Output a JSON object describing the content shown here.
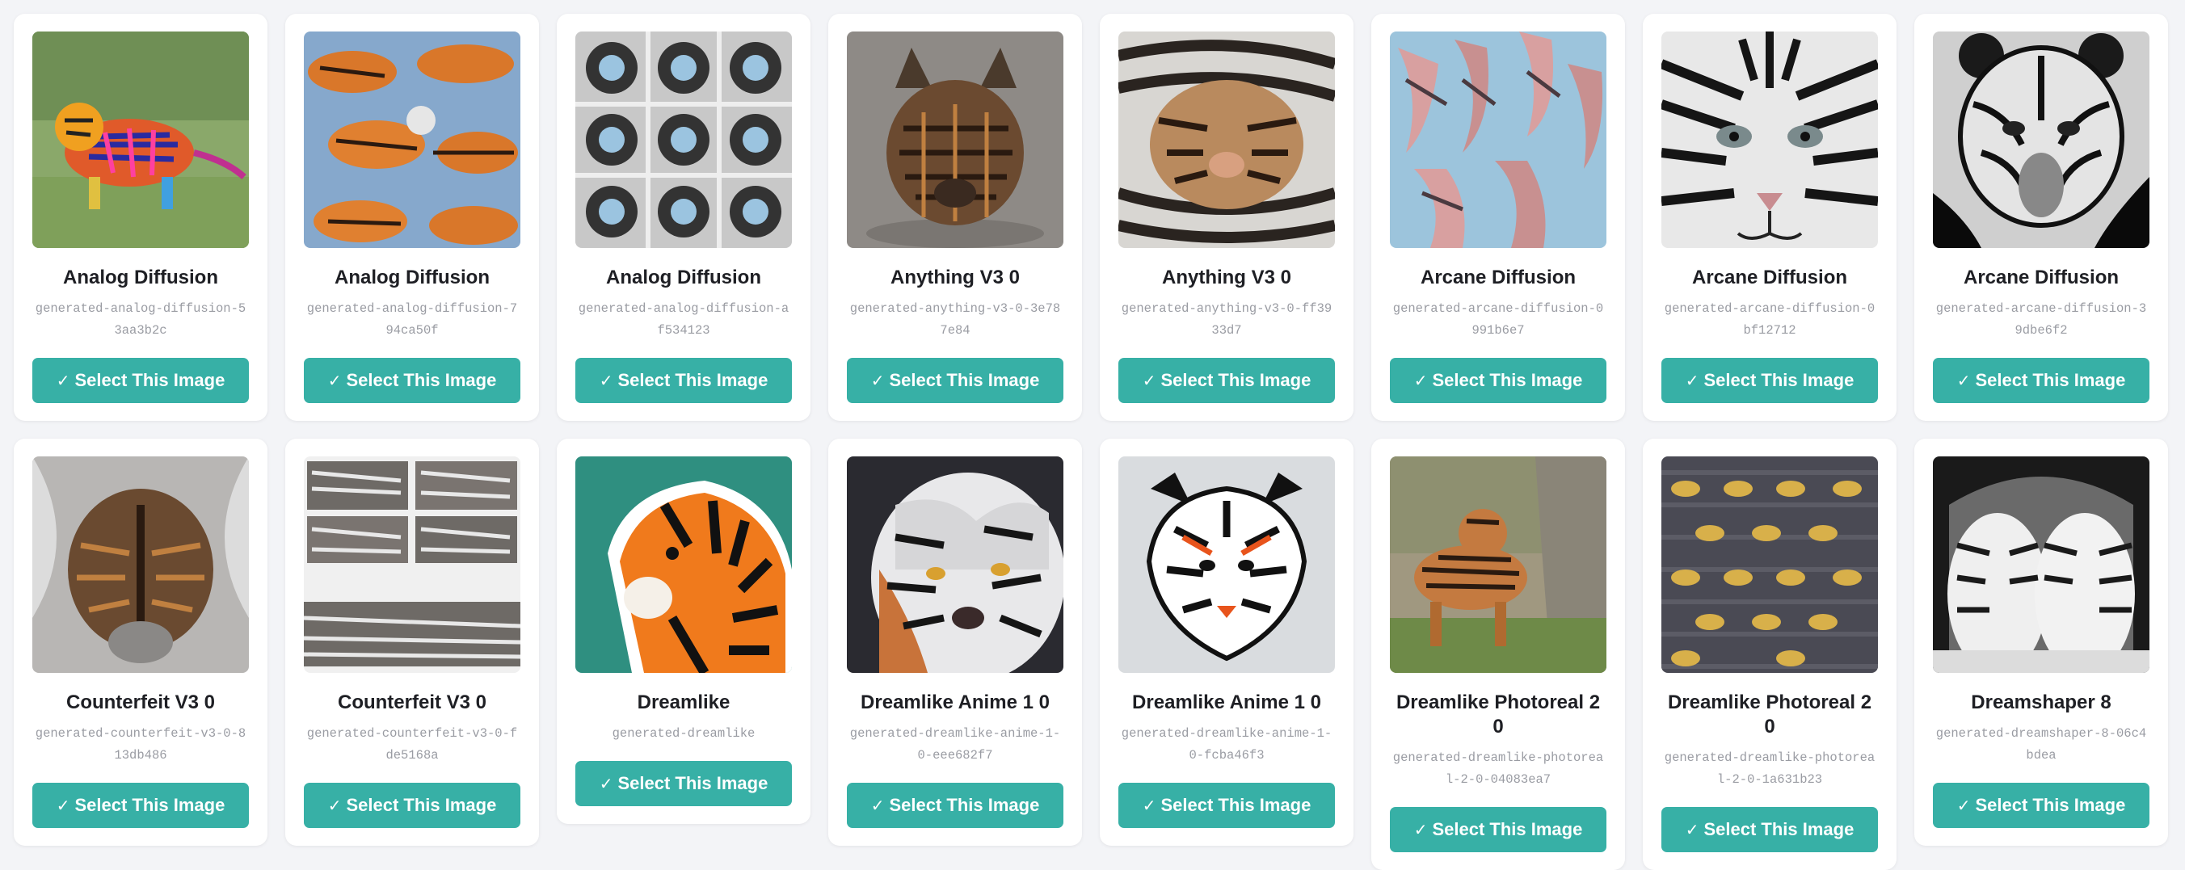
{
  "gallery": {
    "select_button_label": "Select This Image",
    "check_glyph": "✓",
    "accent_color": "#37b0a6",
    "cards": [
      {
        "title": "Analog Diffusion",
        "filename": "generated-analog-diffusion-53aa3b2c"
      },
      {
        "title": "Analog Diffusion",
        "filename": "generated-analog-diffusion-794ca50f"
      },
      {
        "title": "Analog Diffusion",
        "filename": "generated-analog-diffusion-af534123"
      },
      {
        "title": "Anything V3 0",
        "filename": "generated-anything-v3-0-3e787e84"
      },
      {
        "title": "Anything V3 0",
        "filename": "generated-anything-v3-0-ff3933d7"
      },
      {
        "title": "Arcane Diffusion",
        "filename": "generated-arcane-diffusion-0991b6e7"
      },
      {
        "title": "Arcane Diffusion",
        "filename": "generated-arcane-diffusion-0bf12712"
      },
      {
        "title": "Arcane Diffusion",
        "filename": "generated-arcane-diffusion-39dbe6f2"
      },
      {
        "title": "Counterfeit V3 0",
        "filename": "generated-counterfeit-v3-0-813db486"
      },
      {
        "title": "Counterfeit V3 0",
        "filename": "generated-counterfeit-v3-0-fde5168a"
      },
      {
        "title": "Dreamlike",
        "filename": "generated-dreamlike"
      },
      {
        "title": "Dreamlike Anime 1 0",
        "filename": "generated-dreamlike-anime-1-0-eee682f7"
      },
      {
        "title": "Dreamlike Anime 1 0",
        "filename": "generated-dreamlike-anime-1-0-fcba46f3"
      },
      {
        "title": "Dreamlike Photoreal 2 0",
        "filename": "generated-dreamlike-photoreal-2-0-04083ea7"
      },
      {
        "title": "Dreamlike Photoreal 2 0",
        "filename": "generated-dreamlike-photoreal-2-0-1a631b23"
      },
      {
        "title": "Dreamshaper 8",
        "filename": "generated-dreamshaper-8-06c4bdea"
      }
    ]
  }
}
